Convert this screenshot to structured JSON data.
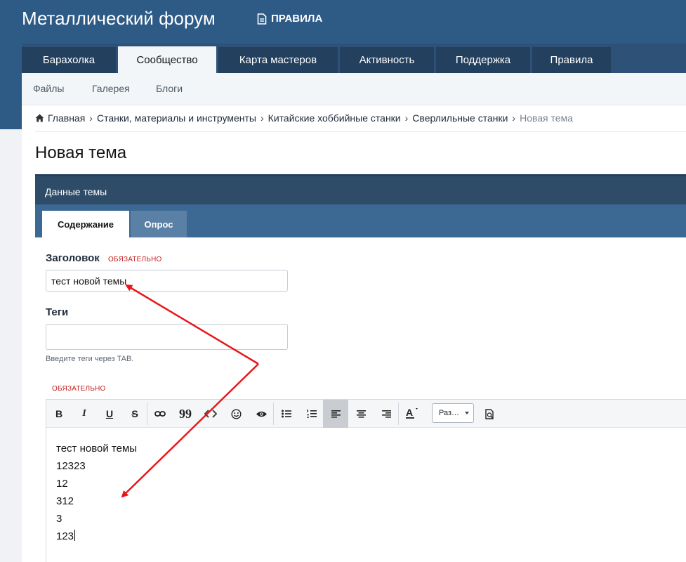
{
  "site": {
    "title": "Металлический форум",
    "rules_link": "ПРАВИЛА"
  },
  "nav": {
    "tabs": [
      {
        "label": "Барахолка"
      },
      {
        "label": "Сообщество"
      },
      {
        "label": "Карта мастеров"
      },
      {
        "label": "Активность"
      },
      {
        "label": "Поддержка"
      },
      {
        "label": "Правила"
      }
    ],
    "active_tab": "Сообщество",
    "subnav": [
      {
        "label": "Файлы"
      },
      {
        "label": "Галерея"
      },
      {
        "label": "Блоги"
      }
    ]
  },
  "breadcrumb": {
    "items": [
      {
        "label": "Главная"
      },
      {
        "label": "Станки, материалы и инструменты"
      },
      {
        "label": "Китайские хоббийные станки"
      },
      {
        "label": "Сверлильные станки"
      }
    ],
    "current": "Новая тема"
  },
  "page": {
    "title": "Новая тема"
  },
  "panel": {
    "title": "Данные темы",
    "tabs": [
      {
        "label": "Содержание"
      },
      {
        "label": "Опрос"
      }
    ],
    "active_tab": "Содержание"
  },
  "form": {
    "title_label": "Заголовок",
    "title_required": "ОБЯЗАТЕЛЬНО",
    "title_value": "тест новой темы",
    "tags_label": "Теги",
    "tags_value": "",
    "tags_hint": "Введите теги через TAB.",
    "content_required": "ОБЯЗАТЕЛЬНО"
  },
  "editor": {
    "toolbar": {
      "bold": "B",
      "italic": "I",
      "underline": "U",
      "strike": "S",
      "quote": "99",
      "size_select": "Раз…"
    },
    "content_lines": [
      {
        "text": "тест новой темы"
      },
      {
        "text": "12323"
      },
      {
        "text": "12"
      },
      {
        "text": "312"
      },
      {
        "text": "3"
      },
      {
        "text": "123"
      }
    ]
  },
  "colors": {
    "header": "#2e5a86",
    "nav_tab": "#23405f",
    "panel_head": "#2e4b68",
    "panel_tabs": "#3c6894",
    "required": "#c32020",
    "arrow": "#e8161b"
  }
}
